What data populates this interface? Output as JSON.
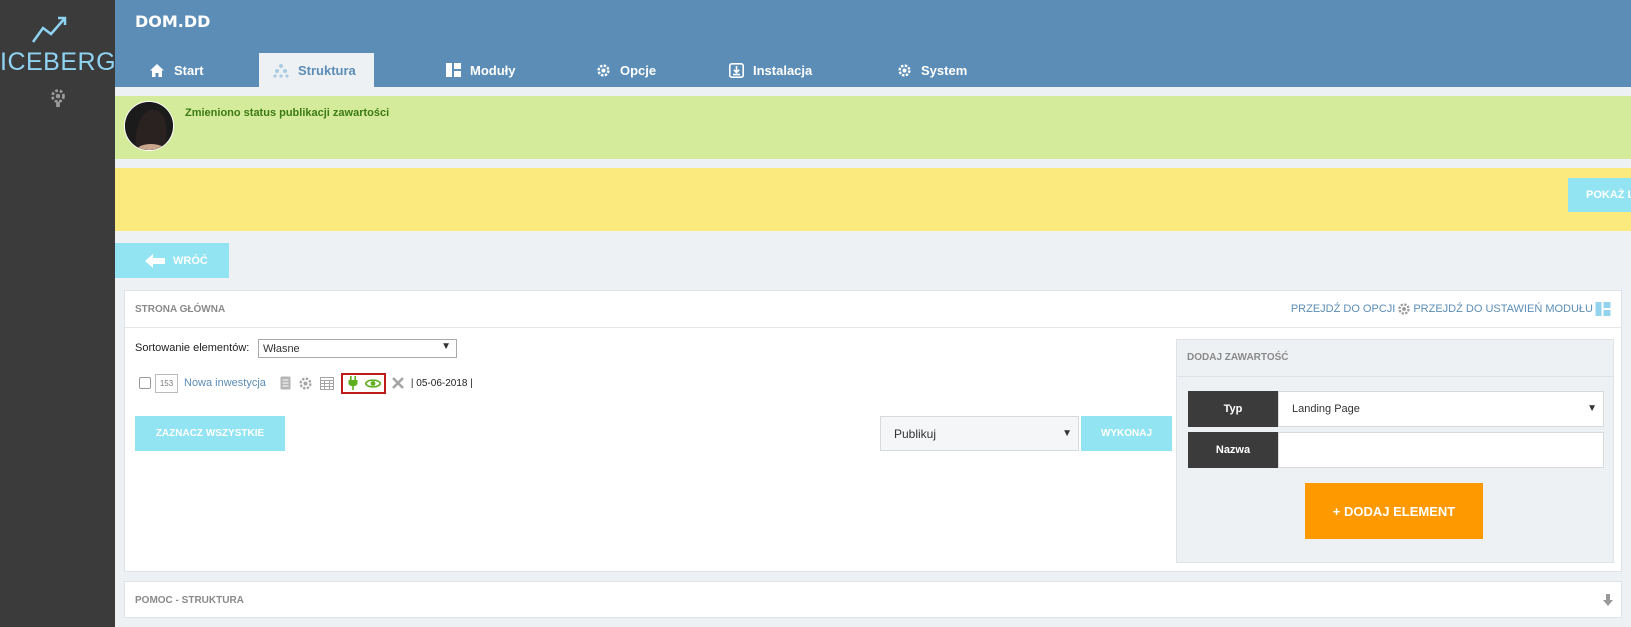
{
  "sidebar": {
    "logo_text": "ICEBERG"
  },
  "header": {
    "app_title": "DOM.DD",
    "tabs": [
      {
        "label": "Start",
        "icon": "home-icon"
      },
      {
        "label": "Struktura",
        "icon": "structure-icon",
        "active": true
      },
      {
        "label": "Moduły",
        "icon": "modules-icon"
      },
      {
        "label": "Opcje",
        "icon": "gear-icon"
      },
      {
        "label": "Instalacja",
        "icon": "install-icon"
      },
      {
        "label": "System",
        "icon": "gear-icon"
      }
    ]
  },
  "notification": {
    "message": "Zmieniono status publikacji zawartości"
  },
  "warning": {
    "button_label": "POKAŻ LISTĘ"
  },
  "back_button": {
    "label": "WRÓĆ"
  },
  "main_panel": {
    "title": "STRONA GŁÓWNA",
    "link_options": "PRZEJDŹ DO OPCJI",
    "link_module_settings": "PRZEJDŹ DO USTAWIEŃ MODUŁU",
    "sort_label": "Sortowanie elementów:",
    "sort_value": "Własne",
    "item": {
      "id": "153",
      "title": "Nowa inwestycja",
      "date": "| 05-06-2018 |"
    },
    "select_all_label": "ZAZNACZ WSZYSTKIE",
    "action_value": "Publikuj",
    "execute_label": "WYKONAJ"
  },
  "add_content": {
    "title": "DODAJ ZAWARTOŚĆ",
    "type_label": "Typ",
    "type_value": "Landing Page",
    "name_label": "Nazwa",
    "name_value": "",
    "add_button_label": "+ DODAJ ELEMENT"
  },
  "help": {
    "title": "POMOC - STRUKTURA"
  },
  "colors": {
    "sidebar": "#3b3b3b",
    "topbar": "#5b8db6",
    "notify_bg": "#d3eb9b",
    "notify_text": "#3c7a14",
    "warn_bg": "#fbeb7f",
    "cyan_button": "#93e4f2",
    "orange_button": "#ff9900",
    "highlight_border": "#c01b1b"
  }
}
